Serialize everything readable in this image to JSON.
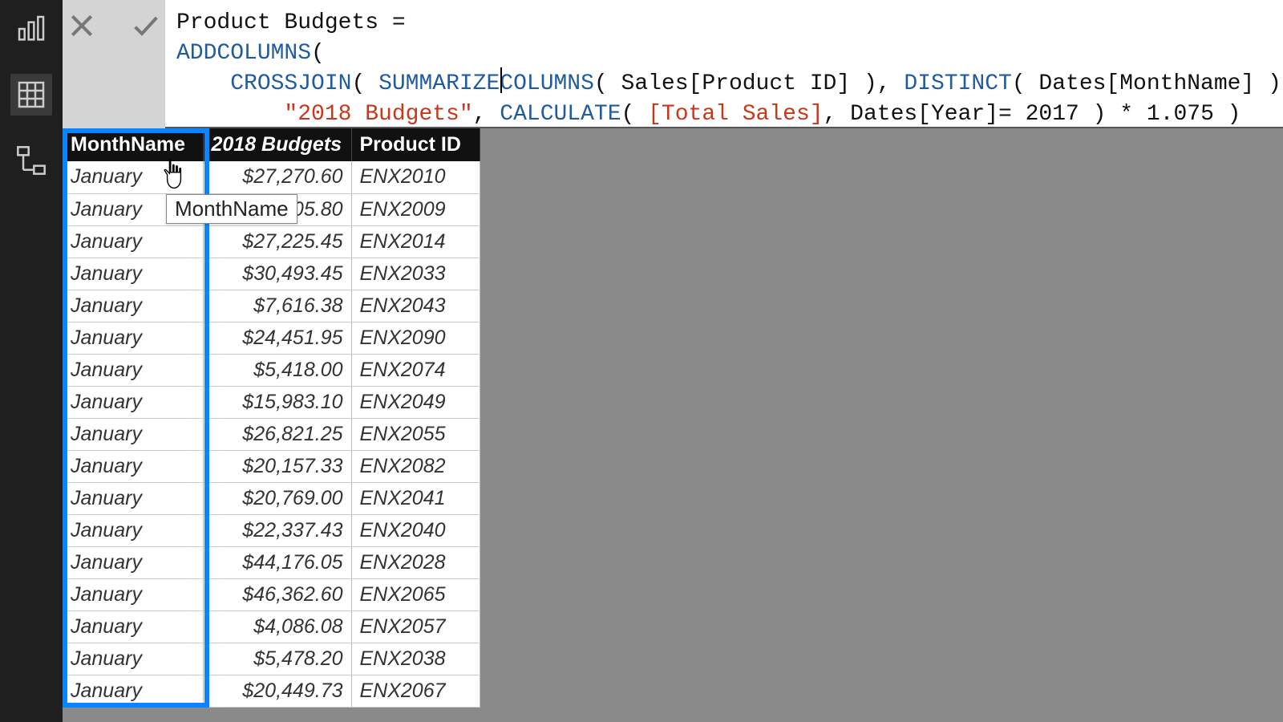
{
  "nav": {
    "report_tooltip": "Report view",
    "data_tooltip": "Data view",
    "model_tooltip": "Model view"
  },
  "formula": {
    "line1_a": "Product Budgets =",
    "line2_a": "ADDCOLUMNS",
    "line2_b": "(",
    "line3_pad": "    ",
    "line3_fn1": "CROSSJOIN",
    "line3_p1": "( ",
    "line3_fn2": "SUMMARIZECOLUMNS",
    "line3_p2": "( ",
    "line3_col1": "Sales[Product ID]",
    "line3_p3": " ), ",
    "line3_fn3": "DISTINCT",
    "line3_p4": "( ",
    "line3_col2": "Dates[MonthName]",
    "line3_p5": " ) ),",
    "line4_pad": "        ",
    "line4_str": "\"2018 Budgets\"",
    "line4_c1": ", ",
    "line4_fn": "CALCULATE",
    "line4_p1": "( ",
    "line4_meas": "[Total Sales]",
    "line4_c2": ", ",
    "line4_col": "Dates[Year]",
    "line4_eq": "= ",
    "line4_num1": "2017",
    "line4_p2": " ) * ",
    "line4_num2": "1.075",
    "line4_p3": " )"
  },
  "tooltip_text": "MonthName",
  "table": {
    "headers": {
      "c1": "MonthName",
      "c2": "2018 Budgets",
      "c3": "Product ID"
    },
    "rows": [
      {
        "m": "January",
        "b": "$27,270.60",
        "p": "ENX2010"
      },
      {
        "m": "January",
        "b": "905.80",
        "p": "ENX2009"
      },
      {
        "m": "January",
        "b": "$27,225.45",
        "p": "ENX2014"
      },
      {
        "m": "January",
        "b": "$30,493.45",
        "p": "ENX2033"
      },
      {
        "m": "January",
        "b": "$7,616.38",
        "p": "ENX2043"
      },
      {
        "m": "January",
        "b": "$24,451.95",
        "p": "ENX2090"
      },
      {
        "m": "January",
        "b": "$5,418.00",
        "p": "ENX2074"
      },
      {
        "m": "January",
        "b": "$15,983.10",
        "p": "ENX2049"
      },
      {
        "m": "January",
        "b": "$26,821.25",
        "p": "ENX2055"
      },
      {
        "m": "January",
        "b": "$20,157.33",
        "p": "ENX2082"
      },
      {
        "m": "January",
        "b": "$20,769.00",
        "p": "ENX2041"
      },
      {
        "m": "January",
        "b": "$22,337.43",
        "p": "ENX2040"
      },
      {
        "m": "January",
        "b": "$44,176.05",
        "p": "ENX2028"
      },
      {
        "m": "January",
        "b": "$46,362.60",
        "p": "ENX2065"
      },
      {
        "m": "January",
        "b": "$4,086.08",
        "p": "ENX2057"
      },
      {
        "m": "January",
        "b": "$5,478.20",
        "p": "ENX2038"
      },
      {
        "m": "January",
        "b": "$20,449.73",
        "p": "ENX2067"
      }
    ]
  }
}
